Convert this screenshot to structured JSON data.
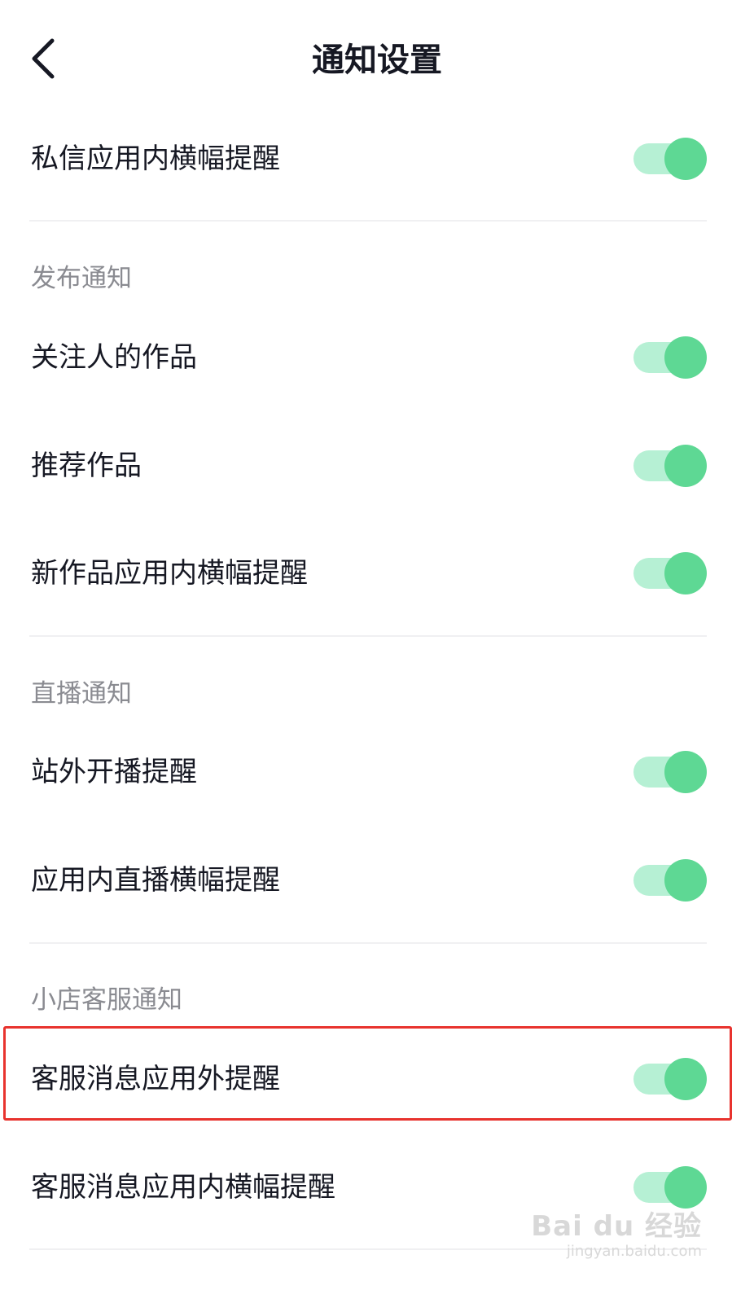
{
  "nav": {
    "title": "通知设置",
    "back_icon": "chevron-left-icon"
  },
  "top_item": {
    "label": "私信应用内横幅提醒",
    "enabled": true
  },
  "sections": [
    {
      "header": "发布通知",
      "items": [
        {
          "label": "关注人的作品",
          "enabled": true
        },
        {
          "label": "推荐作品",
          "enabled": true
        },
        {
          "label": "新作品应用内横幅提醒",
          "enabled": true
        }
      ]
    },
    {
      "header": "直播通知",
      "items": [
        {
          "label": "站外开播提醒",
          "enabled": true
        },
        {
          "label": "应用内直播横幅提醒",
          "enabled": true
        }
      ]
    },
    {
      "header": "小店客服通知",
      "items": [
        {
          "label": "客服消息应用外提醒",
          "enabled": true,
          "highlighted": true
        },
        {
          "label": "客服消息应用内横幅提醒",
          "enabled": true
        }
      ]
    }
  ],
  "watermark": {
    "main": "Bai du 经验",
    "sub": "jingyan.baidu.com"
  },
  "colors": {
    "toggle_track_on": "#b6f0d4",
    "toggle_knob_on": "#5ed894",
    "highlight_border": "#e8332e",
    "section_header_text": "#8a8b91",
    "primary_text": "#161823"
  }
}
